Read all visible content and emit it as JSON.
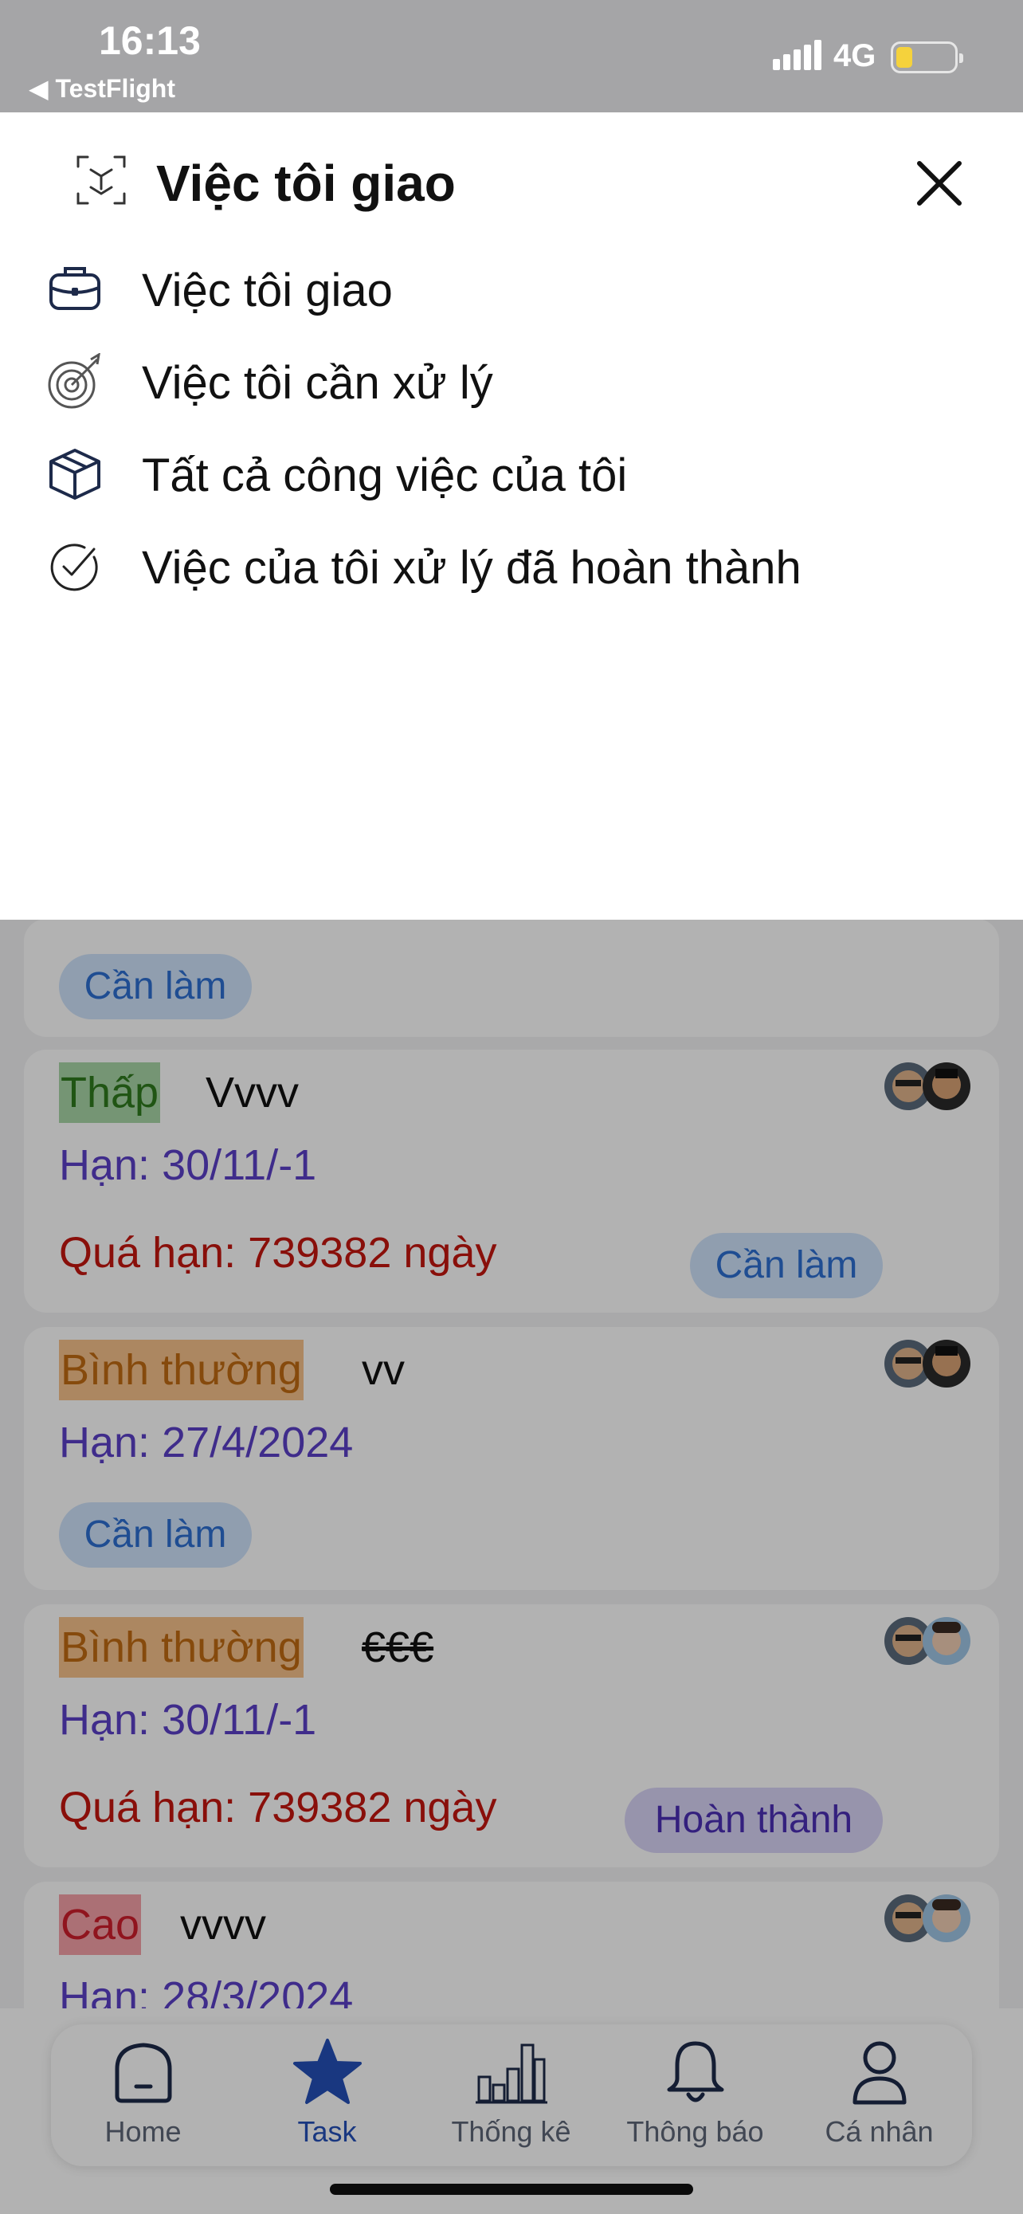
{
  "status_bar": {
    "time": "16:13",
    "back_app": "◀ TestFlight",
    "network": "4G"
  },
  "sheet": {
    "title": "Việc tôi giao",
    "menu": [
      {
        "label": "Việc tôi giao",
        "icon": "briefcase-icon"
      },
      {
        "label": "Việc tôi cần xử lý",
        "icon": "target-icon"
      },
      {
        "label": "Tất cả công việc của tôi",
        "icon": "box-icon"
      },
      {
        "label": "Việc của tôi xử lý đã hoàn thành",
        "icon": "check-circle-icon"
      }
    ]
  },
  "tasks": [
    {
      "status": "Cần làm"
    },
    {
      "priority": "Thấp",
      "title": "Vvvv",
      "due": "Hạn: 30/11/-1",
      "overdue": "Quá hạn: 739382 ngày",
      "status": "Cần làm"
    },
    {
      "priority": "Bình thường",
      "title": "vv",
      "due": "Hạn: 27/4/2024",
      "status": "Cần làm"
    },
    {
      "priority": "Bình thường",
      "title": "€€€",
      "due": "Hạn: 30/11/-1",
      "overdue": "Quá hạn: 739382 ngày",
      "status": "Hoàn thành"
    },
    {
      "priority": "Cao",
      "title": "vvvv",
      "due": "Hạn: 28/3/2024"
    }
  ],
  "tabbar": {
    "tabs": [
      {
        "label": "Home",
        "icon": "home-icon"
      },
      {
        "label": "Task",
        "icon": "star-icon",
        "active": true
      },
      {
        "label": "Thống kê",
        "icon": "chart-icon"
      },
      {
        "label": "Thông báo",
        "icon": "bell-icon"
      },
      {
        "label": "Cá nhân",
        "icon": "user-icon"
      }
    ]
  },
  "colors": {
    "accent": "#2450b8",
    "priority_low": "#2f7a1e",
    "priority_normal": "#c06a12",
    "priority_high": "#cf1d2b",
    "due": "#5b3fc7",
    "overdue": "#c4160f"
  }
}
